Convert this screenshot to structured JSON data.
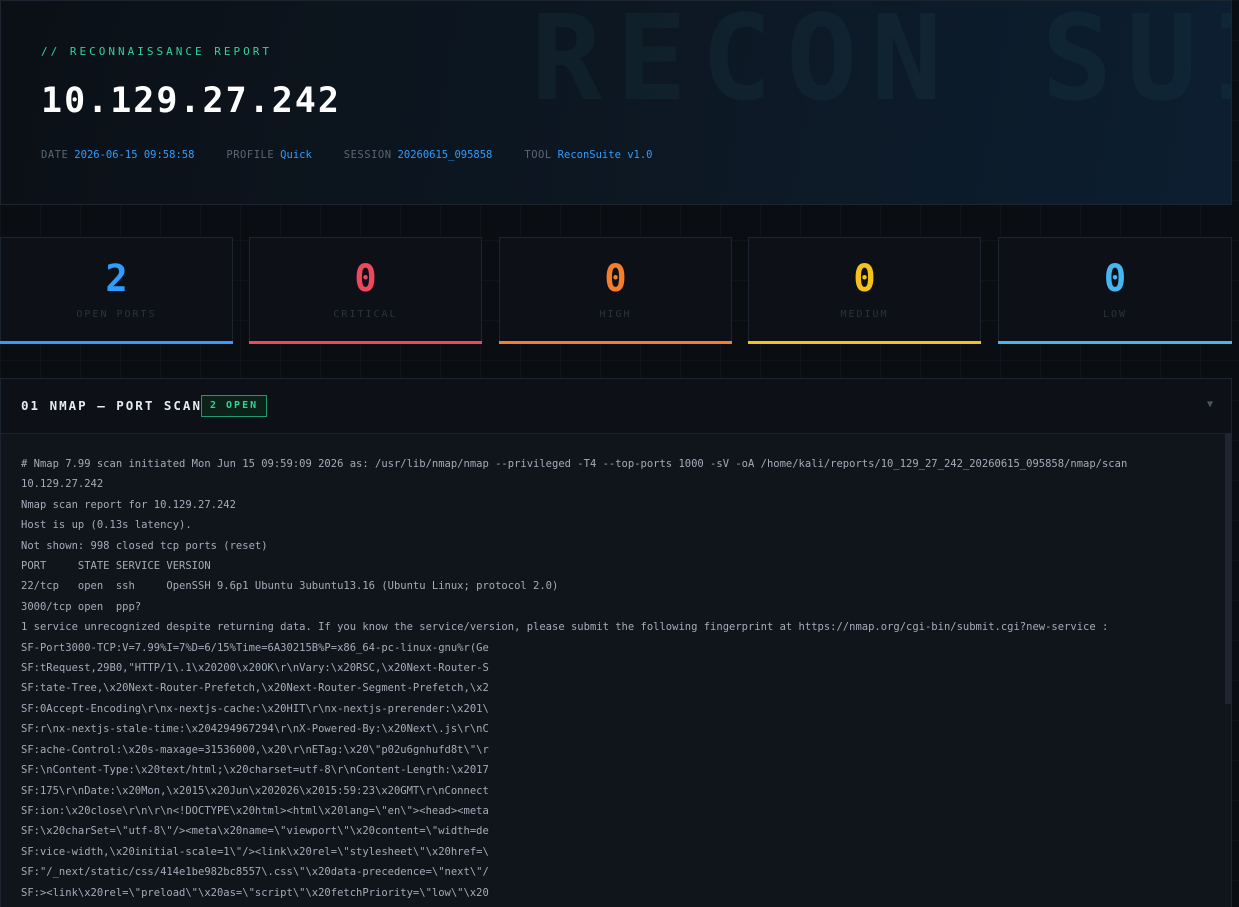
{
  "header": {
    "watermark": "RECON SUITE",
    "eyebrow": "// RECONNAISSANCE REPORT",
    "target": "10.129.27.242",
    "meta": [
      {
        "key": "DATE",
        "value": "2026-06-15 09:58:58"
      },
      {
        "key": "PROFILE",
        "value": "Quick"
      },
      {
        "key": "SESSION",
        "value": "20260615_095858"
      },
      {
        "key": "TOOL",
        "value": "ReconSuite v1.0"
      }
    ]
  },
  "cards": [
    {
      "value": "2",
      "label": "OPEN PORTS",
      "color": "#2f9cff"
    },
    {
      "value": "0",
      "label": "CRITICAL",
      "color": "#f0475c"
    },
    {
      "value": "0",
      "label": "HIGH",
      "color": "#f57e2a"
    },
    {
      "value": "0",
      "label": "MEDIUM",
      "color": "#f5c21b"
    },
    {
      "value": "0",
      "label": "LOW",
      "color": "#46b6f0"
    }
  ],
  "section": {
    "title": "01  NMAP — PORT SCAN",
    "badge": "2 OPEN",
    "chevron": "▼",
    "lines": [
      "# Nmap 7.99 scan initiated Mon Jun 15 09:59:09 2026 as: /usr/lib/nmap/nmap --privileged -T4 --top-ports 1000 -sV -oA /home/kali/reports/10_129_27_242_20260615_095858/nmap/scan",
      "10.129.27.242",
      "Nmap scan report for 10.129.27.242",
      "Host is up (0.13s latency).",
      "Not shown: 998 closed tcp ports (reset)",
      "PORT     STATE SERVICE VERSION",
      "22/tcp   open  ssh     OpenSSH 9.6p1 Ubuntu 3ubuntu13.16 (Ubuntu Linux; protocol 2.0)",
      "3000/tcp open  ppp?",
      "1 service unrecognized despite returning data. If you know the service/version, please submit the following fingerprint at https://nmap.org/cgi-bin/submit.cgi?new-service :",
      "SF-Port3000-TCP:V=7.99%I=7%D=6/15%Time=6A30215B%P=x86_64-pc-linux-gnu%r(Ge",
      "SF:tRequest,29B0,\"HTTP/1\\.1\\x20200\\x20OK\\r\\nVary:\\x20RSC,\\x20Next-Router-S",
      "SF:tate-Tree,\\x20Next-Router-Prefetch,\\x20Next-Router-Segment-Prefetch,\\x2",
      "SF:0Accept-Encoding\\r\\nx-nextjs-cache:\\x20HIT\\r\\nx-nextjs-prerender:\\x201\\",
      "SF:r\\nx-nextjs-stale-time:\\x204294967294\\r\\nX-Powered-By:\\x20Next\\.js\\r\\nC",
      "SF:ache-Control:\\x20s-maxage=31536000,\\x20\\r\\nETag:\\x20\\\"p02u6gnhufd8t\\\"\\r",
      "SF:\\nContent-Type:\\x20text/html;\\x20charset=utf-8\\r\\nContent-Length:\\x2017",
      "SF:175\\r\\nDate:\\x20Mon,\\x2015\\x20Jun\\x202026\\x2015:59:23\\x20GMT\\r\\nConnect",
      "SF:ion:\\x20close\\r\\n\\r\\n<!DOCTYPE\\x20html><html\\x20lang=\\\"en\\\"><head><meta",
      "SF:\\x20charSet=\\\"utf-8\\\"/><meta\\x20name=\\\"viewport\\\"\\x20content=\\\"width=de",
      "SF:vice-width,\\x20initial-scale=1\\\"/><link\\x20rel=\\\"stylesheet\\\"\\x20href=\\",
      "SF:\"/_next/static/css/414e1be982bc8557\\.css\\\"\\x20data-precedence=\\\"next\\\"/",
      "SF:><link\\x20rel=\\\"preload\\\"\\x20as=\\\"script\\\"\\x20fetchPriority=\\\"low\\\"\\x20"
    ]
  }
}
